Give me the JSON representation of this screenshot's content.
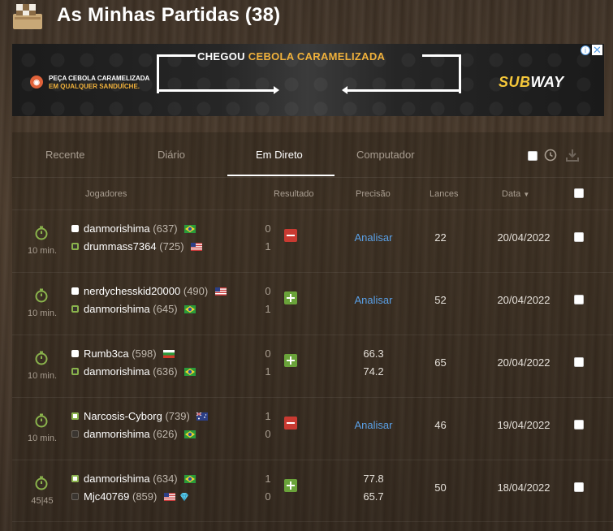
{
  "header": {
    "title": "As Minhas Partidas (38)",
    "icon": "chess-pieces-icon"
  },
  "ad": {
    "left_line1": "PEÇA CEBOLA CARAMELIZADA",
    "left_line2": "EM QUALQUER SANDUÍCHE.",
    "headline_white": "CHEGOU",
    "headline_accent": "CEBOLA CARAMELIZADA",
    "brand_part1": "SUB",
    "brand_part2": "WAY",
    "info_label": "i",
    "close_label": "✕",
    "colors": {
      "accent": "#f0b13b",
      "brand": "#f6c83a"
    }
  },
  "tabs": [
    {
      "label": "Recente",
      "active": false
    },
    {
      "label": "Diário",
      "active": false
    },
    {
      "label": "Em Direto",
      "active": true
    },
    {
      "label": "Computador",
      "active": false
    }
  ],
  "columns": {
    "players": "Jogadores",
    "result": "Resultado",
    "accuracy": "Precisão",
    "moves": "Lances",
    "date": "Data"
  },
  "games": [
    {
      "time_control": "10 min.",
      "white": {
        "name": "danmorishima",
        "rating": "(637)",
        "flag": "brazil"
      },
      "black": {
        "name": "drummass7364",
        "rating": "(725)",
        "flag": "usa"
      },
      "score_white": "0",
      "score_black": "1",
      "outcome": "loss",
      "analyze": "Analisar",
      "accuracy_white": "",
      "accuracy_black": "",
      "moves": "22",
      "date": "20/04/2022"
    },
    {
      "time_control": "10 min.",
      "white": {
        "name": "nerdychesskid20000",
        "rating": "(490)",
        "flag": "usa"
      },
      "black": {
        "name": "danmorishima",
        "rating": "(645)",
        "flag": "brazil"
      },
      "score_white": "0",
      "score_black": "1",
      "outcome": "win",
      "analyze": "Analisar",
      "accuracy_white": "",
      "accuracy_black": "",
      "moves": "52",
      "date": "20/04/2022"
    },
    {
      "time_control": "10 min.",
      "white": {
        "name": "Rumb3ca",
        "rating": "(598)",
        "flag": "bulgaria"
      },
      "black": {
        "name": "danmorishima",
        "rating": "(636)",
        "flag": "brazil"
      },
      "score_white": "0",
      "score_black": "1",
      "outcome": "win",
      "analyze": "",
      "accuracy_white": "66.3",
      "accuracy_black": "74.2",
      "moves": "65",
      "date": "20/04/2022"
    },
    {
      "time_control": "10 min.",
      "white": {
        "name": "Narcosis-Cyborg",
        "rating": "(739)",
        "flag": "australia"
      },
      "black": {
        "name": "danmorishima",
        "rating": "(626)",
        "flag": "brazil"
      },
      "score_white": "1",
      "score_black": "0",
      "outcome": "loss",
      "analyze": "Analisar",
      "accuracy_white": "",
      "accuracy_black": "",
      "moves": "46",
      "date": "19/04/2022"
    },
    {
      "time_control": "45|45",
      "white": {
        "name": "danmorishima",
        "rating": "(634)",
        "flag": "brazil"
      },
      "black": {
        "name": "Mjc40769",
        "rating": "(859)",
        "flag": "usa",
        "badge": "diamond-icon"
      },
      "score_white": "1",
      "score_black": "0",
      "outcome": "win",
      "analyze": "",
      "accuracy_white": "77.8",
      "accuracy_black": "65.7",
      "moves": "50",
      "date": "18/04/2022"
    }
  ]
}
